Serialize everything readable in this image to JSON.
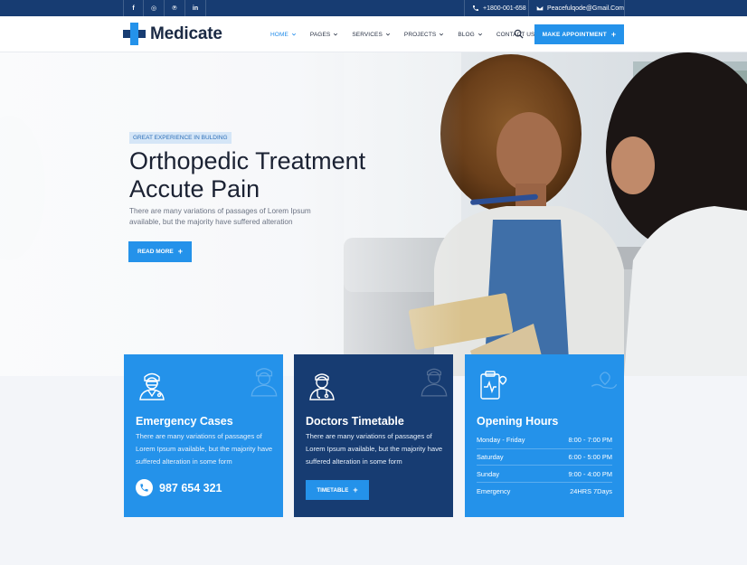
{
  "topbar": {
    "social": [
      {
        "icon": "facebook-icon",
        "glyph": "f"
      },
      {
        "icon": "instagram-icon",
        "glyph": "◎"
      },
      {
        "icon": "pinterest-icon",
        "glyph": "℗"
      },
      {
        "icon": "linkedin-icon",
        "glyph": "in"
      }
    ],
    "phone": "+1800-001-658",
    "email": "Peacefulqode@Gmail.Com"
  },
  "brand": {
    "name": "Medicate"
  },
  "nav": {
    "items": [
      {
        "label": "HOME",
        "active": true,
        "dropdown": true
      },
      {
        "label": "PAGES",
        "active": false,
        "dropdown": true
      },
      {
        "label": "SERVICES",
        "active": false,
        "dropdown": true
      },
      {
        "label": "PROJECTS",
        "active": false,
        "dropdown": true
      },
      {
        "label": "BLOG",
        "active": false,
        "dropdown": true
      },
      {
        "label": "CONTACT US",
        "active": false,
        "dropdown": false
      }
    ],
    "cta": "MAKE APPOINTMENT"
  },
  "hero": {
    "badge": "GREAT EXPERIENCE IN BULDING",
    "title_line1": "Orthopedic Treatment",
    "title_line2": "Accute Pain",
    "description": "There are many variations of passages of Lorem Ipsum available, but the majority have suffered alteration",
    "button": "READ MORE"
  },
  "cards": {
    "emergency": {
      "title": "Emergency Cases",
      "text": "There are many variations of passages of Lorem Ipsum available, but the majority have suffered alteration in some form",
      "phone": "987 654 321"
    },
    "timetable": {
      "title": "Doctors Timetable",
      "text": "There are many variations of passages of Lorem Ipsum available, but the majority have suffered alteration in some form",
      "button": "TIMETABLE"
    },
    "hours": {
      "title": "Opening Hours",
      "rows": [
        {
          "day": "Monday - Friday",
          "time": "8:00 - 7:00 PM"
        },
        {
          "day": "Saturday",
          "time": "6:00 - 5:00 PM"
        },
        {
          "day": "Sunday",
          "time": "9:00 - 4:00 PM"
        },
        {
          "day": "Emergency",
          "time": "24HRS 7Days"
        }
      ]
    }
  },
  "colors": {
    "primary": "#2492ea",
    "dark": "#173c72",
    "text": "#1b2233"
  }
}
